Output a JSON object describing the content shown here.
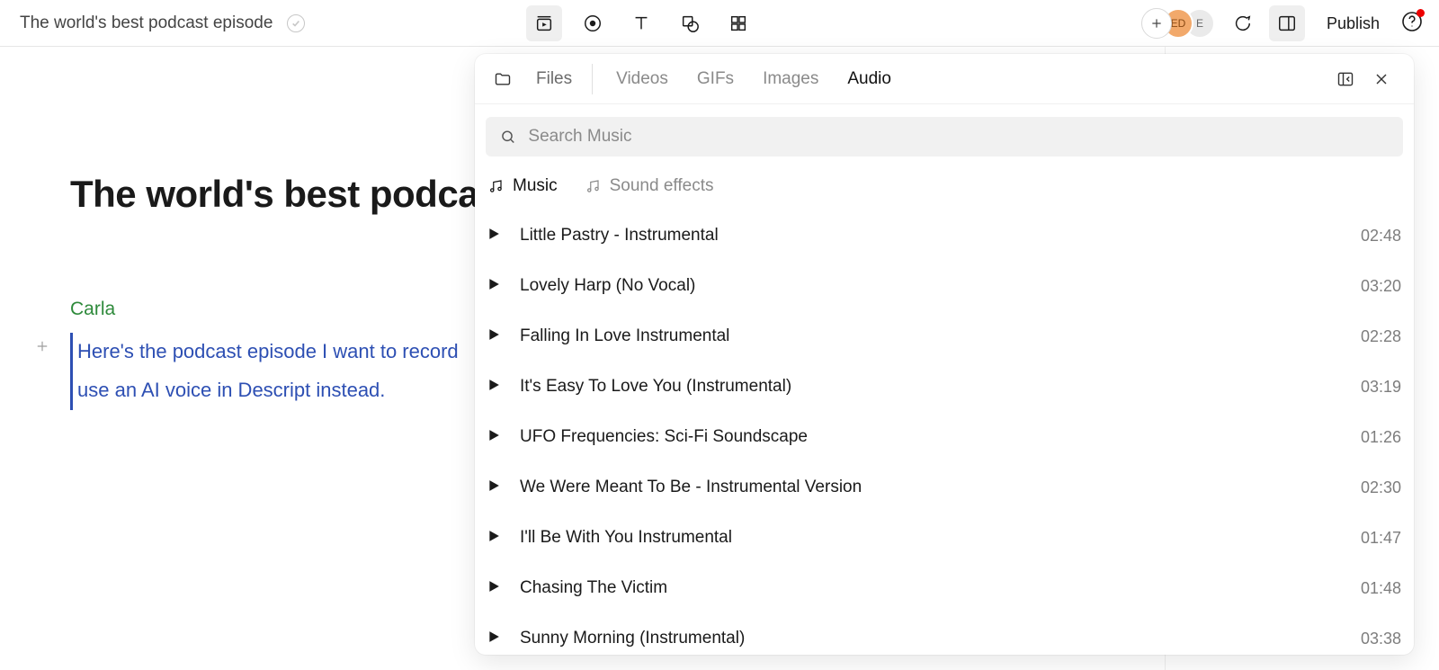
{
  "doc": {
    "title": "The world's best podcast episode",
    "heading": "The world's best podcast epis",
    "speaker": "Carla",
    "script_line1": "Here's the podcast episode I want to record",
    "script_line2": "use an AI voice in Descript instead."
  },
  "toolbar": {
    "publish": "Publish",
    "avatars": {
      "a1": "ED",
      "a2": "E"
    }
  },
  "panel": {
    "tabs": {
      "files": "Files",
      "videos": "Videos",
      "gifs": "GIFs",
      "images": "Images",
      "audio": "Audio"
    },
    "search_placeholder": "Search Music",
    "categories": {
      "music": "Music",
      "sfx": "Sound effects"
    },
    "tracks": [
      {
        "name": "Little Pastry - Instrumental",
        "dur": "02:48"
      },
      {
        "name": "Lovely Harp (No Vocal)",
        "dur": "03:20"
      },
      {
        "name": "Falling In Love Instrumental",
        "dur": "02:28"
      },
      {
        "name": "It's Easy To Love You (Instrumental)",
        "dur": "03:19"
      },
      {
        "name": "UFO Frequencies: Sci-Fi Soundscape",
        "dur": "01:26"
      },
      {
        "name": "We Were Meant To Be - Instrumental Version",
        "dur": "02:30"
      },
      {
        "name": "I'll Be With You Instrumental",
        "dur": "01:47"
      },
      {
        "name": "Chasing The Victim",
        "dur": "01:48"
      },
      {
        "name": "Sunny Morning (Instrumental)",
        "dur": "03:38"
      }
    ]
  }
}
